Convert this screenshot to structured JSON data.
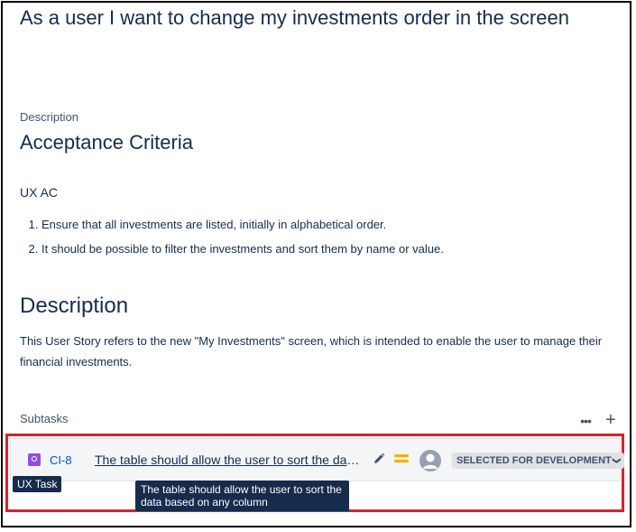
{
  "issue": {
    "summary": "As a user I want to change my investments order in the screen",
    "description_label": "Description"
  },
  "description": {
    "acceptance_heading": "Acceptance Criteria",
    "ux_ac_title": "UX AC",
    "criteria": [
      "Ensure that all investments are listed, initially in alphabetical order.",
      "It should be possible to filter the investments and sort them by name or value."
    ],
    "heading": "Description",
    "text": "This User Story refers to the new \"My Investments\" screen, which is intended to enable the user to manage their financial investments."
  },
  "subtasks": {
    "title": "Subtasks",
    "more_icon": "more-icon",
    "add_icon": "plus-icon",
    "items": [
      {
        "type_icon": "ux-task-icon",
        "key": "CI-8",
        "summary": "The table should allow the user to sort the data based on any column",
        "edit_icon": "pencil-icon",
        "priority_icon": "priority-medium-icon",
        "assignee_icon": "unassigned-avatar-icon",
        "status": "SELECTED FOR DEVELOPMENT",
        "status_icon": "chevron-down-icon"
      }
    ]
  },
  "tooltips": {
    "type": "UX Task",
    "summary": "The table should allow the user to sort the data based on any column"
  },
  "colors": {
    "highlight_border": "#e01f26",
    "link": "#0052cc",
    "ux_task_icon": "#904ee2",
    "priority": "#ffab00",
    "tooltip_bg": "#172b4d",
    "text": "#172b4d"
  }
}
